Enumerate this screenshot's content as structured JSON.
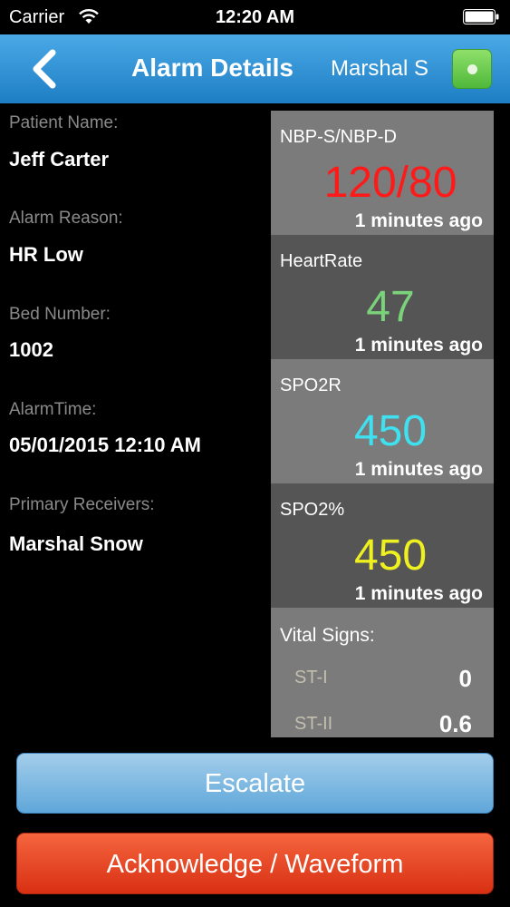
{
  "status_bar": {
    "carrier": "Carrier",
    "time": "12:20 AM"
  },
  "nav": {
    "title": "Alarm Details",
    "user": "Marshal S",
    "back_icon": "chevron-left-icon",
    "status_color": "#5cc13f"
  },
  "patient": {
    "name_label": "Patient Name:",
    "name": "Jeff Carter",
    "reason_label": "Alarm Reason:",
    "reason": "HR Low",
    "bed_label": "Bed Number:",
    "bed": "1002",
    "time_label": "AlarmTime:",
    "time": "05/01/2015 12:10 AM",
    "receivers_label": "Primary Receivers:",
    "receivers": "Marshal Snow"
  },
  "tiles": [
    {
      "label": "NBP-S/NBP-D",
      "value": "120/80",
      "ago": "1 minutes ago",
      "color": "#ff1a1a"
    },
    {
      "label": "HeartRate",
      "value": "47",
      "ago": "1 minutes ago",
      "color": "#7ad27a"
    },
    {
      "label": "SPO2R",
      "value": "450",
      "ago": "1 minutes ago",
      "color": "#3fe0f0"
    },
    {
      "label": "SPO2%",
      "value": "450",
      "ago": "1 minutes ago",
      "color": "#eef020"
    }
  ],
  "vitals": {
    "title": "Vital Signs:",
    "items": [
      {
        "name": "ST-I",
        "value": "0"
      },
      {
        "name": "ST-II",
        "value": "0.6"
      }
    ]
  },
  "buttons": {
    "escalate": "Escalate",
    "acknowledge": "Acknowledge / Waveform"
  }
}
